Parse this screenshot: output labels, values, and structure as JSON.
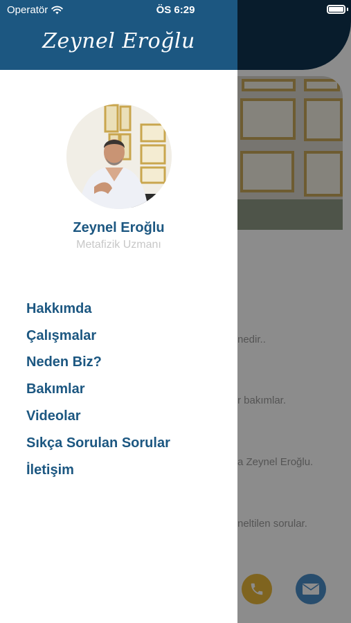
{
  "status_bar": {
    "carrier": "Operatör",
    "time": "ÖS 6:29"
  },
  "drawer": {
    "signature": "Zeynel Eroğlu",
    "profile": {
      "name": "Zeynel Eroğlu",
      "title": "Metafizik Uzmanı"
    },
    "menu": [
      {
        "label": "Hakkımda"
      },
      {
        "label": "Çalışmalar"
      },
      {
        "label": "Neden Biz?"
      },
      {
        "label": "Bakımlar"
      },
      {
        "label": "Videolar"
      },
      {
        "label": "Sıkça Sorulan Sorular"
      },
      {
        "label": "İletişim"
      }
    ]
  },
  "background": {
    "lines": [
      "nedir..",
      "r bakımlar.",
      "a Zeynel Eroğlu.",
      "neltilen sorular."
    ]
  },
  "colors": {
    "header_dark": "#0f3451",
    "drawer_header": "#1c5781",
    "menu_text": "#1c5781",
    "phone_fab": "#e8b63a",
    "mail_fab": "#4a8cc6"
  }
}
